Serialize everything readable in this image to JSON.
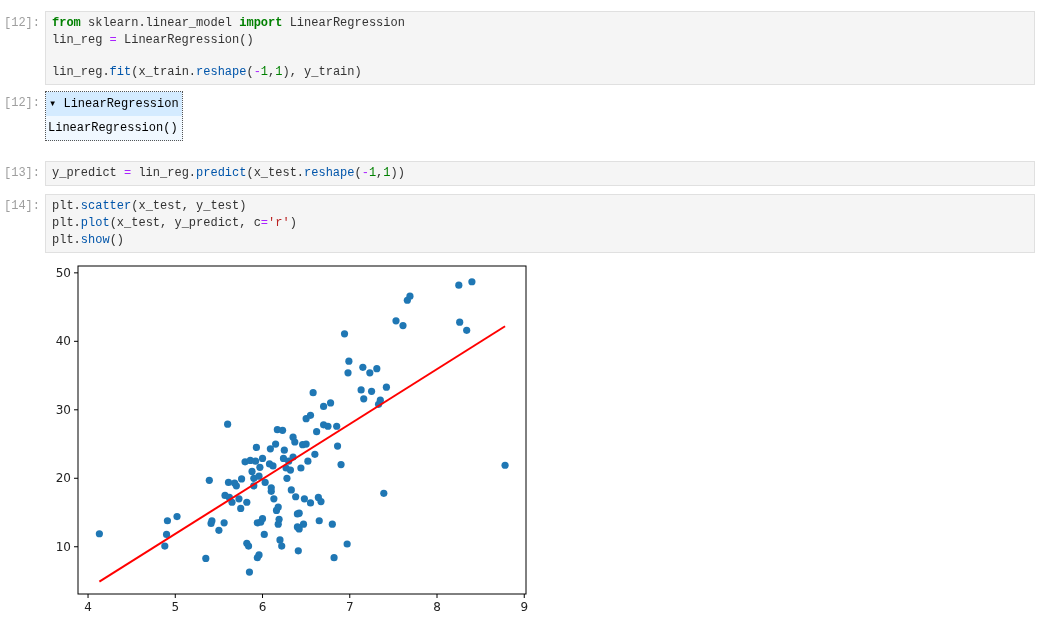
{
  "cells": [
    {
      "kind": "code",
      "prompt": "[12]:",
      "lines": [
        {
          "tokens": [
            {
              "t": "from",
              "kind": "kw"
            },
            {
              "t": " sklearn.linear_model ",
              "kind": "plain"
            },
            {
              "t": "import",
              "kind": "kw"
            },
            {
              "t": " LinearRegression",
              "kind": "plain"
            }
          ]
        },
        {
          "tokens": [
            {
              "t": "lin_reg ",
              "kind": "plain"
            },
            {
              "t": "=",
              "kind": "op"
            },
            {
              "t": " LinearRegression()",
              "kind": "plain"
            }
          ]
        },
        {
          "kind": "blank"
        },
        {
          "kind": "text",
          "tokens": [
            {
              "t": "lin_reg.",
              "kind": "plain"
            },
            {
              "t": "fit",
              "kind": "fn"
            },
            {
              "t": "(x_train.",
              "kind": "plain"
            },
            {
              "t": "reshape",
              "kind": "fn"
            },
            {
              "t": "(",
              "kind": "plain"
            },
            {
              "t": "-",
              "kind": "op"
            },
            {
              "t": "1",
              "kind": "num"
            },
            {
              "t": ",",
              "kind": "plain"
            },
            {
              "t": "1",
              "kind": "num"
            },
            {
              "t": "), y_train)",
              "kind": "plain"
            }
          ]
        }
      ]
    },
    {
      "kind": "estimator",
      "prompt": "[12]:",
      "header": "▾ LinearRegression",
      "body": "LinearRegression()"
    },
    {
      "kind": "code",
      "prompt": "[13]:",
      "lines": [
        {
          "tokens": [
            {
              "t": "y_predict ",
              "kind": "plain"
            },
            {
              "t": "=",
              "kind": "op"
            },
            {
              "t": " lin_reg.",
              "kind": "plain"
            },
            {
              "t": "predict",
              "kind": "fn"
            },
            {
              "t": "(x_test.",
              "kind": "plain"
            },
            {
              "t": "reshape",
              "kind": "fn"
            },
            {
              "t": "(",
              "kind": "plain"
            },
            {
              "t": "-",
              "kind": "op"
            },
            {
              "t": "1",
              "kind": "num"
            },
            {
              "t": ",",
              "kind": "plain"
            },
            {
              "t": "1",
              "kind": "num"
            },
            {
              "t": "))",
              "kind": "plain"
            }
          ]
        }
      ]
    },
    {
      "kind": "code",
      "prompt": "[14]:",
      "lines": [
        {
          "tokens": [
            {
              "t": "plt.",
              "kind": "plain"
            },
            {
              "t": "scatter",
              "kind": "fn"
            },
            {
              "t": "(x_test, y_test)",
              "kind": "plain"
            }
          ]
        },
        {
          "tokens": [
            {
              "t": "plt.",
              "kind": "plain"
            },
            {
              "t": "plot",
              "kind": "fn"
            },
            {
              "t": "(x_test, y_predict, c",
              "kind": "plain"
            },
            {
              "t": "=",
              "kind": "op"
            },
            {
              "t": "'r'",
              "kind": "str"
            },
            {
              "t": ")",
              "kind": "plain"
            }
          ]
        },
        {
          "tokens": [
            {
              "t": "plt.",
              "kind": "plain"
            },
            {
              "t": "show",
              "kind": "fn"
            },
            {
              "t": "()",
              "kind": "plain"
            }
          ]
        }
      ]
    },
    {
      "kind": "plot",
      "chart_data": {
        "type": "scatter",
        "xlim": [
          3.885,
          9.02
        ],
        "ylim": [
          3.1,
          51.0
        ],
        "xticks": [
          4,
          5,
          6,
          7,
          8,
          9
        ],
        "yticks": [
          10,
          20,
          30,
          40,
          50
        ],
        "series": [
          {
            "type": "scatter",
            "color": "#1f77b4",
            "x": [
              4.13,
              4.88,
              4.9,
              4.91,
              5.02,
              5.35,
              5.39,
              5.41,
              5.42,
              5.5,
              5.56,
              5.57,
              5.6,
              5.61,
              5.62,
              5.65,
              5.68,
              5.7,
              5.73,
              5.75,
              5.76,
              5.8,
              5.82,
              5.82,
              5.84,
              5.85,
              5.86,
              5.88,
              5.9,
              5.9,
              5.92,
              5.93,
              5.94,
              5.94,
              5.96,
              5.96,
              5.97,
              5.98,
              6.0,
              6.0,
              6.02,
              6.03,
              6.08,
              6.09,
              6.1,
              6.1,
              6.12,
              6.13,
              6.15,
              6.16,
              6.17,
              6.18,
              6.18,
              6.19,
              6.2,
              6.22,
              6.23,
              6.24,
              6.25,
              6.27,
              6.28,
              6.3,
              6.32,
              6.33,
              6.35,
              6.35,
              6.37,
              6.38,
              6.4,
              6.4,
              6.41,
              6.42,
              6.42,
              6.44,
              6.46,
              6.47,
              6.48,
              6.5,
              6.5,
              6.52,
              6.55,
              6.55,
              6.58,
              6.6,
              6.62,
              6.64,
              6.65,
              6.67,
              6.7,
              6.7,
              6.75,
              6.78,
              6.8,
              6.82,
              6.85,
              6.86,
              6.9,
              6.94,
              6.97,
              6.98,
              6.99,
              7.13,
              7.15,
              7.16,
              7.23,
              7.25,
              7.31,
              7.33,
              7.35,
              7.39,
              7.42,
              7.53,
              7.61,
              7.66,
              7.69,
              8.25,
              8.26,
              8.34,
              8.4,
              8.78
            ],
            "values": [
              11.9,
              10.1,
              11.8,
              13.8,
              14.4,
              8.3,
              19.7,
              13.4,
              13.8,
              12.4,
              13.5,
              17.5,
              27.9,
              19.4,
              17.2,
              16.5,
              19.3,
              18.9,
              17.0,
              15.6,
              19.9,
              22.4,
              16.5,
              10.5,
              10.1,
              6.3,
              22.6,
              21.0,
              20.0,
              18.9,
              22.5,
              24.5,
              13.5,
              8.4,
              8.8,
              20.3,
              21.6,
              13.6,
              14.1,
              22.9,
              11.8,
              19.4,
              22.1,
              24.3,
              18.6,
              18.1,
              21.8,
              17.0,
              25.0,
              15.3,
              27.1,
              15.8,
              13.3,
              14.0,
              11.0,
              10.1,
              27.0,
              22.9,
              24.1,
              21.5,
              20.0,
              22.5,
              21.2,
              18.3,
              23.1,
              26.0,
              25.3,
              17.3,
              14.8,
              12.9,
              9.4,
              14.9,
              12.6,
              21.5,
              24.9,
              13.3,
              17.0,
              28.7,
              25.0,
              22.5,
              16.4,
              29.2,
              32.5,
              23.5,
              26.8,
              17.2,
              13.8,
              16.6,
              30.5,
              27.8,
              27.6,
              31.0,
              13.3,
              8.4,
              27.6,
              24.7,
              22.0,
              41.1,
              10.4,
              35.4,
              37.1,
              32.9,
              36.2,
              31.6,
              35.4,
              32.7,
              36.0,
              30.8,
              31.4,
              17.8,
              33.3,
              43.0,
              42.3,
              46.0,
              46.6,
              48.2,
              42.8,
              41.6,
              48.7,
              21.9
            ]
          },
          {
            "type": "line",
            "color": "#ff0000",
            "x": [
              4.13,
              8.78
            ],
            "values": [
              4.9,
              42.2
            ]
          }
        ]
      }
    }
  ]
}
